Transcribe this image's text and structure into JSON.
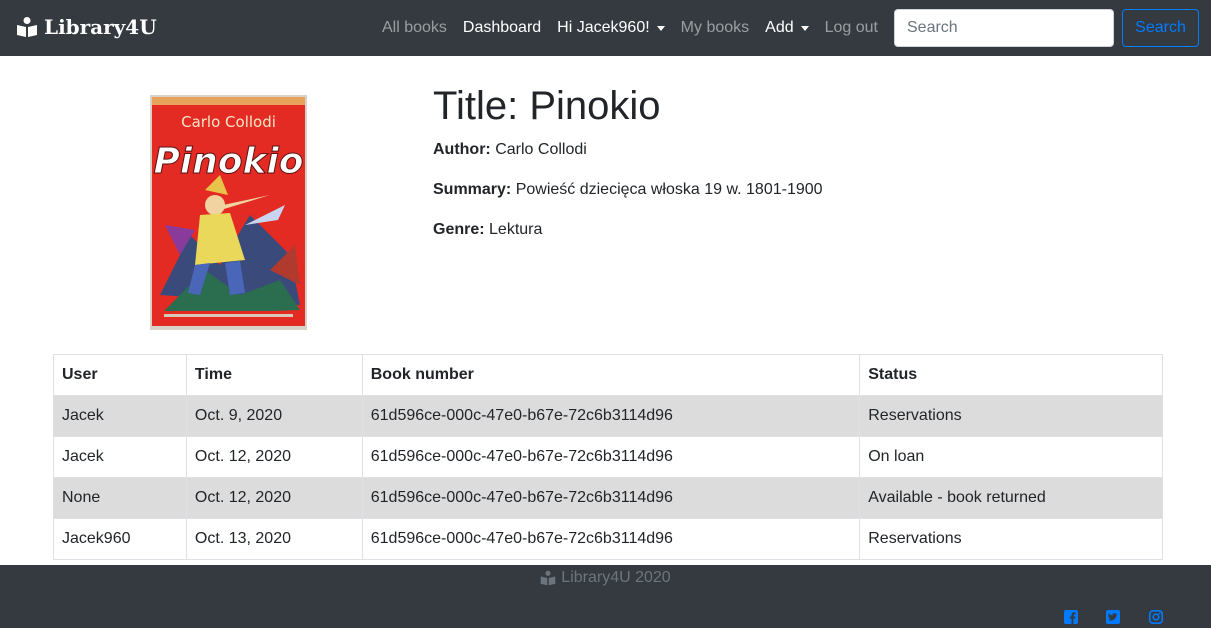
{
  "navbar": {
    "brand": "Library4U",
    "links": {
      "all_books": "All books",
      "dashboard": "Dashboard",
      "user_menu": "Hi Jacek960!",
      "my_books": "My books",
      "add": "Add",
      "logout": "Log out"
    },
    "search": {
      "placeholder": "Search",
      "button": "Search"
    }
  },
  "book": {
    "title_label": "Title:",
    "title": "Pinokio",
    "author_label": "Author:",
    "author": "Carlo Collodi",
    "summary_label": "Summary:",
    "summary": "Powieść dziecięca włoska 19 w. 1801-1900",
    "genre_label": "Genre:",
    "genre": "Lektura",
    "cover": {
      "author_text": "Carlo Collodi",
      "title_text": "Pinokio"
    }
  },
  "table": {
    "headers": {
      "user": "User",
      "time": "Time",
      "book_number": "Book number",
      "status": "Status"
    },
    "rows": [
      {
        "user": "Jacek",
        "time": "Oct. 9, 2020",
        "book_number": "61d596ce-000c-47e0-b67e-72c6b3114d96",
        "status": "Reservations"
      },
      {
        "user": "Jacek",
        "time": "Oct. 12, 2020",
        "book_number": "61d596ce-000c-47e0-b67e-72c6b3114d96",
        "status": "On loan"
      },
      {
        "user": "None",
        "time": "Oct. 12, 2020",
        "book_number": "61d596ce-000c-47e0-b67e-72c6b3114d96",
        "status": "Available - book returned"
      },
      {
        "user": "Jacek960",
        "time": "Oct. 13, 2020",
        "book_number": "61d596ce-000c-47e0-b67e-72c6b3114d96",
        "status": "Reservations"
      }
    ]
  },
  "footer": {
    "text": "Library4U 2020",
    "social_icons": [
      "facebook-icon",
      "twitter-icon",
      "instagram-icon"
    ]
  },
  "colors": {
    "navbar_bg": "#343a40",
    "accent": "#007bff",
    "striped_row": "#dcdcdc"
  }
}
